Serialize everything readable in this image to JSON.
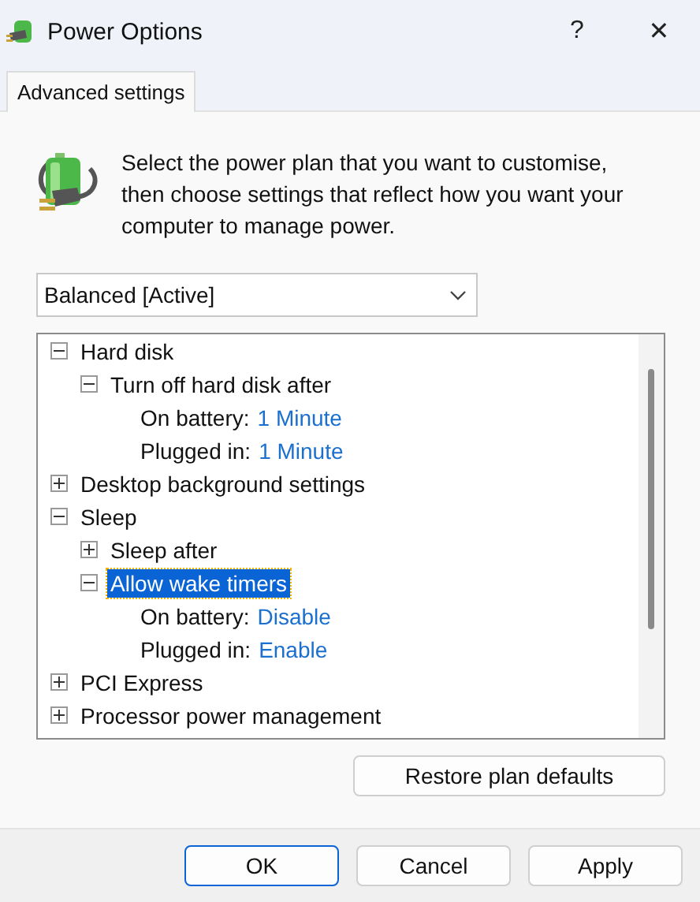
{
  "window": {
    "title": "Power Options",
    "help": "?",
    "close": "✕"
  },
  "tabs": [
    {
      "label": "Advanced settings",
      "selected": true
    }
  ],
  "intro": "Select the power plan that you want to customise, then choose settings that reflect how you want your computer to manage power.",
  "plan_select": {
    "value": "Balanced [Active]"
  },
  "tree": [
    {
      "kind": "group",
      "label": "Hard disk",
      "expanded": true,
      "selected": false,
      "children": [
        {
          "kind": "group",
          "label": "Turn off hard disk after",
          "expanded": true,
          "selected": false,
          "children": [
            {
              "kind": "setting",
              "label": "On battery:",
              "value": "1 Minute"
            },
            {
              "kind": "setting",
              "label": "Plugged in:",
              "value": "1 Minute"
            }
          ]
        }
      ]
    },
    {
      "kind": "group",
      "label": "Desktop background settings",
      "expanded": false,
      "selected": false
    },
    {
      "kind": "group",
      "label": "Sleep",
      "expanded": true,
      "selected": false,
      "children": [
        {
          "kind": "group",
          "label": "Sleep after",
          "expanded": false,
          "selected": false
        },
        {
          "kind": "group",
          "label": "Allow wake timers",
          "expanded": true,
          "selected": true,
          "children": [
            {
              "kind": "setting",
              "label": "On battery:",
              "value": "Disable"
            },
            {
              "kind": "setting",
              "label": "Plugged in:",
              "value": "Enable"
            }
          ]
        }
      ]
    },
    {
      "kind": "group",
      "label": "PCI Express",
      "expanded": false,
      "selected": false
    },
    {
      "kind": "group",
      "label": "Processor power management",
      "expanded": false,
      "selected": false
    }
  ],
  "restore_button": "Restore plan defaults",
  "buttons": [
    {
      "label": "OK",
      "default": true
    },
    {
      "label": "Cancel",
      "default": false
    },
    {
      "label": "Apply",
      "default": false
    }
  ]
}
